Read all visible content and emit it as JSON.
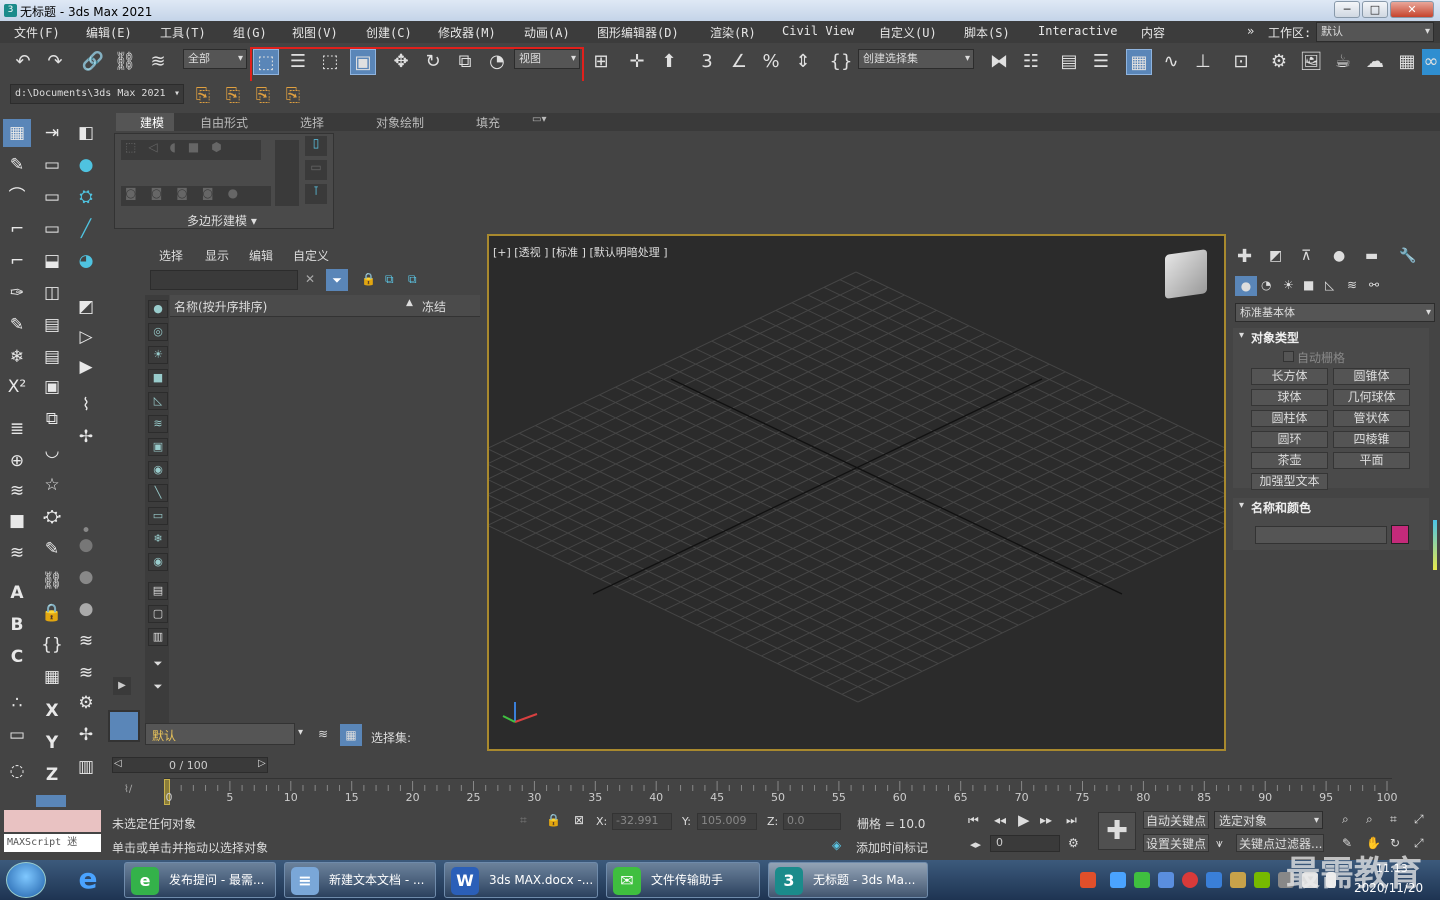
{
  "window": {
    "title": "无标题 - 3ds Max 2021",
    "min": "─",
    "max": "□",
    "close": "✕"
  },
  "menu": [
    "文件(F)",
    "编辑(E)",
    "工具(T)",
    "组(G)",
    "视图(V)",
    "创建(C)",
    "修改器(M)",
    "动画(A)",
    "图形编辑器(D)",
    "渲染(R)",
    "Civil View",
    "自定义(U)",
    "脚本(S)",
    "Interactive",
    "内容"
  ],
  "menu_right": {
    "chevron": "»",
    "workspace_label": "工作区:",
    "workspace_value": "默认"
  },
  "toolbar": {
    "filter_value": "全部",
    "ref_coord_value": "视图",
    "selection_set_value": "创建选择集"
  },
  "project_path": "d:\\Documents\\3ds Max 2021",
  "ribbon": {
    "tabs": [
      "建模",
      "自由形式",
      "选择",
      "对象绘制",
      "填充"
    ],
    "panel_label": "多边形建模 ▾"
  },
  "scene_explorer": {
    "menu": [
      "选择",
      "显示",
      "编辑",
      "自定义"
    ],
    "col_name": "名称(按升序排序)",
    "col_sort": "▲",
    "col_frozen": "冻结",
    "layer_value": "默认",
    "selection_set_label": "选择集:"
  },
  "viewport": {
    "label": "[+] [透视 ] [标准 ] [默认明暗处理 ]"
  },
  "command_panel": {
    "category": "标准基本体",
    "rollout_object_type": "对象类型",
    "autogrid": "自动栅格",
    "buttons": [
      "长方体",
      "圆锥体",
      "球体",
      "几何球体",
      "圆柱体",
      "管状体",
      "圆环",
      "四棱锥",
      "茶壶",
      "平面",
      "加强型文本"
    ],
    "rollout_name_color": "名称和颜色",
    "object_color": "#c42a7a"
  },
  "timeline": {
    "frame_display": "0 / 100",
    "ticks": [
      "0",
      "5",
      "10",
      "15",
      "20",
      "25",
      "30",
      "35",
      "40",
      "45",
      "50",
      "55",
      "60",
      "65",
      "70",
      "75",
      "80",
      "85",
      "90",
      "95",
      "100"
    ]
  },
  "status": {
    "maxscript": "MAXScript 迷",
    "line1": "未选定任何对象",
    "line2": "单击或单击并拖动以选择对象",
    "x_label": "X:",
    "x_value": "-32.991",
    "y_label": "Y:",
    "y_value": "105.009",
    "z_label": "Z:",
    "z_value": "0.0",
    "grid": "栅格 = 10.0",
    "add_time_tag": "添加时间标记",
    "auto_key": "自动关键点",
    "selected_object": "选定对象",
    "set_key": "设置关键点",
    "key_filter": "关键点过滤器...",
    "frame_value": "0"
  },
  "taskbar": {
    "items": [
      {
        "label": "发布提问 - 最需...",
        "color": "#34b24a",
        "glyph": "e"
      },
      {
        "label": "新建文本文档 - ...",
        "color": "#7aa7d8",
        "glyph": "≡"
      },
      {
        "label": "3ds MAX.docx -...",
        "color": "#2b5fb8",
        "glyph": "W"
      },
      {
        "label": "文件传输助手",
        "color": "#3fbf3f",
        "glyph": "✉"
      },
      {
        "label": "无标题 - 3ds Ma...",
        "color": "#1b8b8b",
        "glyph": "3"
      }
    ],
    "clock_time": "11:13",
    "clock_date": "2020/11/20",
    "watermark": "最需教育"
  }
}
